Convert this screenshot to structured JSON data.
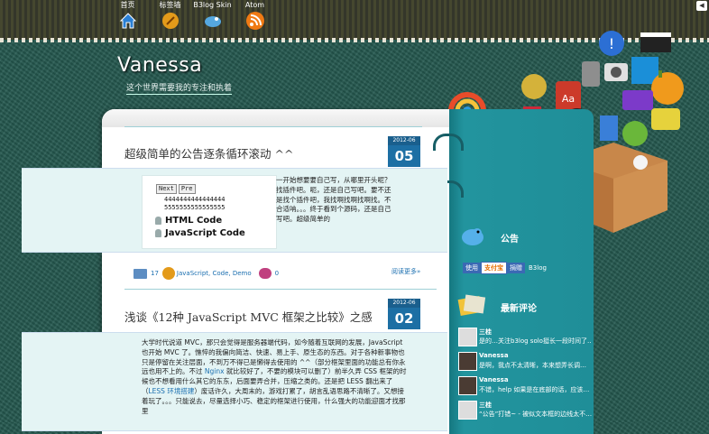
{
  "colors": {
    "accent": "#1d6fa4",
    "sidebar": "#1e8c96",
    "link": "#1b6fb0"
  },
  "nav": [
    {
      "label": "首页",
      "icon": "home-icon",
      "color": "#2a7fd4"
    },
    {
      "label": "标签墙",
      "icon": "tag-icon",
      "color": "#e39a1a"
    },
    {
      "label": "B3log Skin",
      "icon": "bird-icon",
      "color": "#55a8e0"
    },
    {
      "label": "Atom",
      "icon": "rss-icon",
      "color": "#f07a14"
    }
  ],
  "site": {
    "title": "Vanessa",
    "subtitle": "这个世界需要我的专注和执着"
  },
  "posts": [
    {
      "title": "超级简单的公告逐条循环滚动 ^^",
      "date_ym": "2012-06",
      "date_day": "05",
      "buttons": [
        "Next",
        "Pre"
      ],
      "code_lines": [
        "4444444444444444",
        "5555555555555555"
      ],
      "code_items": [
        "HTML Code",
        "JavaScript Code"
      ],
      "text": "一开始想要要自己写，从哪里开头呢？找插件吧。呃，还是自己写吧。要不还是找个插件吧，我找啊找啊找啊找。不合适呐。。。终于看到个源码，还是自己写吧。超级简单的",
      "comment_count": "17",
      "tags": "JavaScript, Code, Demo",
      "view_count": "0",
      "readmore": "阅读更多»"
    },
    {
      "title": "浅谈《12种 JavaScript MVC 框架之比较》之感",
      "date_ym": "2012-06",
      "date_day": "02",
      "text_a": "大学时代说道 MVC，那只会觉得是服务器端代码，如今随着互联网的发展，JavaScript 也开始 MVC 了。憔悴的我偏向简洁、快速、易上手、原生态的东西。对于各种新事物也只是停留在关注层面，不到万不得已是懒得去使用的 ^^（部分框架里面的功能总有你永远也用不上的。不过 ",
      "link1": "Nginx",
      "text_b": " 就比较好了，不要的模块可以删了）前半久弄 CSS 框架的时候也不想看用什么其它的东东，后面要弄合并，压缩之类的。还是把 LESS 翻出来了（",
      "link2": "LESS 环境搭建",
      "text_c": "）废话许久，大周末的，游戏打累了，胡言乱语思路不清晰了。又想接着玩了。。。只能说去，尽量选择小巧、稳定的框架进行使用，什么强大的功能迎面才找那里"
    }
  ],
  "sidebar": {
    "notice_title": "公告",
    "donate": {
      "a": "使用",
      "b": "支付宝",
      "c": "捐赠",
      "d": "B3log"
    },
    "comments_title": "最新评论",
    "comments": [
      {
        "name": "三桂",
        "text": "是的…关注b3log solo挺长一段时间了…"
      },
      {
        "name": "Vanessa",
        "text": "是啊，我点不太清晰，本来想弄长调…"
      },
      {
        "name": "Vanessa",
        "text": "不错，help 如果是在底部的话，应该…"
      },
      {
        "name": "三桂",
        "text": "“公告”打错~ - 被似文本框的边线太不…"
      }
    ]
  },
  "ui": {
    "collapse_icon": "collapse-arrow-icon"
  }
}
